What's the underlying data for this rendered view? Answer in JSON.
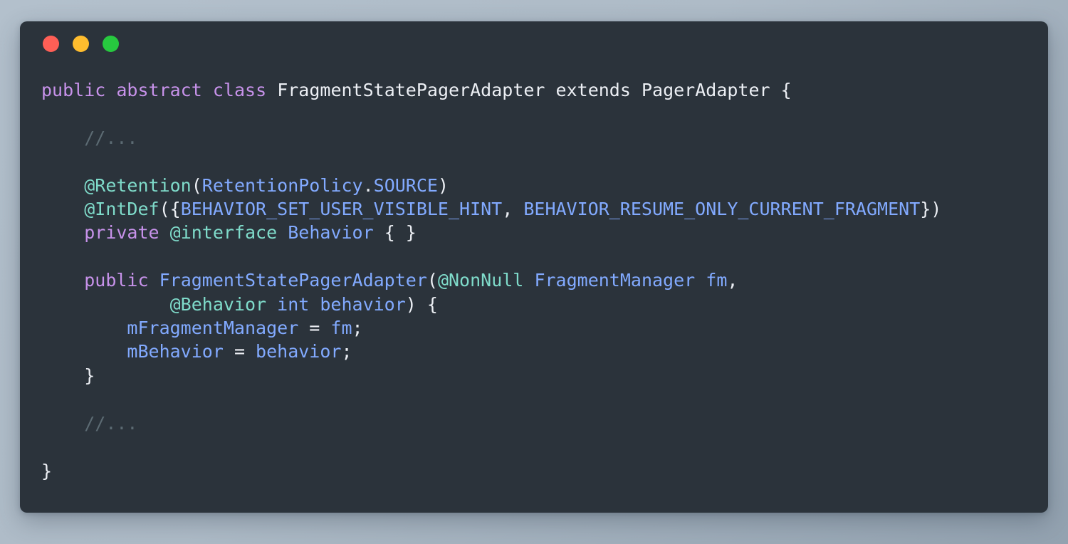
{
  "window": {
    "traffic_lights": [
      {
        "name": "close",
        "color": "#ff5f56"
      },
      {
        "name": "minimize",
        "color": "#ffbd2e"
      },
      {
        "name": "maximize",
        "color": "#27c93f"
      }
    ]
  },
  "theme": {
    "page_background": "#aebbc7",
    "card_background": "#2b333b",
    "keyword": "#c792ea",
    "annotation": "#7fdbca",
    "identifier": "#82aaff",
    "plain": "#eceff4",
    "comment": "#5c6b73"
  },
  "code": {
    "language": "java",
    "lines": [
      {
        "indent": 0,
        "tokens": [
          {
            "t": "public",
            "c": "kw"
          },
          {
            "t": " ",
            "c": "plain"
          },
          {
            "t": "abstract",
            "c": "kw"
          },
          {
            "t": " ",
            "c": "plain"
          },
          {
            "t": "class",
            "c": "kw"
          },
          {
            "t": " ",
            "c": "plain"
          },
          {
            "t": "FragmentStatePagerAdapter",
            "c": "cls"
          },
          {
            "t": " ",
            "c": "plain"
          },
          {
            "t": "extends",
            "c": "plain"
          },
          {
            "t": " ",
            "c": "plain"
          },
          {
            "t": "PagerAdapter",
            "c": "cls"
          },
          {
            "t": " {",
            "c": "plain"
          }
        ]
      },
      {
        "indent": 0,
        "tokens": []
      },
      {
        "indent": 1,
        "tokens": [
          {
            "t": "//...",
            "c": "cmt"
          }
        ]
      },
      {
        "indent": 0,
        "tokens": []
      },
      {
        "indent": 1,
        "tokens": [
          {
            "t": "@Retention",
            "c": "ann"
          },
          {
            "t": "(",
            "c": "plain"
          },
          {
            "t": "RetentionPolicy",
            "c": "id"
          },
          {
            "t": ".",
            "c": "plain"
          },
          {
            "t": "SOURCE",
            "c": "id"
          },
          {
            "t": ")",
            "c": "plain"
          }
        ]
      },
      {
        "indent": 1,
        "tokens": [
          {
            "t": "@IntDef",
            "c": "ann"
          },
          {
            "t": "({",
            "c": "plain"
          },
          {
            "t": "BEHAVIOR_SET_USER_VISIBLE_HINT",
            "c": "id"
          },
          {
            "t": ", ",
            "c": "plain"
          },
          {
            "t": "BEHAVIOR_RESUME_ONLY_CURRENT_FRAGMENT",
            "c": "id"
          },
          {
            "t": "})",
            "c": "plain"
          }
        ]
      },
      {
        "indent": 1,
        "tokens": [
          {
            "t": "private",
            "c": "kw"
          },
          {
            "t": " ",
            "c": "plain"
          },
          {
            "t": "@interface",
            "c": "ann"
          },
          {
            "t": " ",
            "c": "plain"
          },
          {
            "t": "Behavior",
            "c": "id"
          },
          {
            "t": " { }",
            "c": "plain"
          }
        ]
      },
      {
        "indent": 0,
        "tokens": []
      },
      {
        "indent": 1,
        "tokens": [
          {
            "t": "public",
            "c": "kw"
          },
          {
            "t": " ",
            "c": "plain"
          },
          {
            "t": "FragmentStatePagerAdapter",
            "c": "id"
          },
          {
            "t": "(",
            "c": "plain"
          },
          {
            "t": "@NonNull",
            "c": "ann"
          },
          {
            "t": " ",
            "c": "plain"
          },
          {
            "t": "FragmentManager",
            "c": "id"
          },
          {
            "t": " ",
            "c": "plain"
          },
          {
            "t": "fm",
            "c": "id"
          },
          {
            "t": ",",
            "c": "plain"
          }
        ]
      },
      {
        "indent": 3,
        "tokens": [
          {
            "t": "@Behavior",
            "c": "ann"
          },
          {
            "t": " ",
            "c": "plain"
          },
          {
            "t": "int",
            "c": "id"
          },
          {
            "t": " ",
            "c": "plain"
          },
          {
            "t": "behavior",
            "c": "id"
          },
          {
            "t": ") {",
            "c": "plain"
          }
        ]
      },
      {
        "indent": 2,
        "tokens": [
          {
            "t": "mFragmentManager",
            "c": "id"
          },
          {
            "t": " = ",
            "c": "plain"
          },
          {
            "t": "fm",
            "c": "id"
          },
          {
            "t": ";",
            "c": "plain"
          }
        ]
      },
      {
        "indent": 2,
        "tokens": [
          {
            "t": "mBehavior",
            "c": "id"
          },
          {
            "t": " = ",
            "c": "plain"
          },
          {
            "t": "behavior",
            "c": "id"
          },
          {
            "t": ";",
            "c": "plain"
          }
        ]
      },
      {
        "indent": 1,
        "tokens": [
          {
            "t": "}",
            "c": "plain"
          }
        ]
      },
      {
        "indent": 0,
        "tokens": []
      },
      {
        "indent": 1,
        "tokens": [
          {
            "t": "//...",
            "c": "cmt"
          }
        ]
      },
      {
        "indent": 0,
        "tokens": []
      },
      {
        "indent": 0,
        "tokens": [
          {
            "t": "}",
            "c": "plain"
          }
        ]
      }
    ]
  }
}
